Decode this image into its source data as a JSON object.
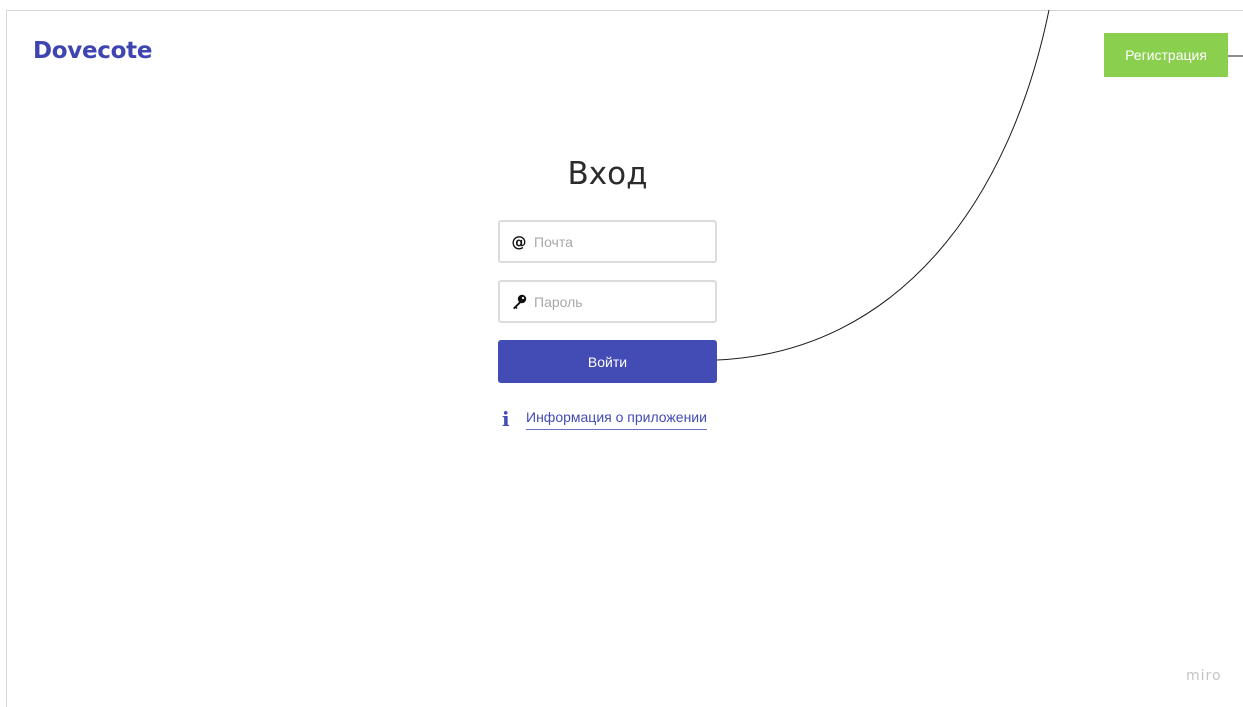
{
  "brand": {
    "logo_text": "Dovecote",
    "color": "#3f45b0"
  },
  "header": {
    "register_label": "Регистрация",
    "register_color": "#8bcf4f"
  },
  "login": {
    "title": "Вход",
    "email": {
      "placeholder": "Почта",
      "value": "",
      "icon": "at-icon"
    },
    "password": {
      "placeholder": "Пароль",
      "value": "",
      "icon": "key-icon"
    },
    "submit_label": "Войти",
    "submit_color": "#434bb4",
    "info": {
      "icon": "info-icon",
      "label": "Информация о приложении"
    }
  },
  "watermark": {
    "text": "miro"
  }
}
